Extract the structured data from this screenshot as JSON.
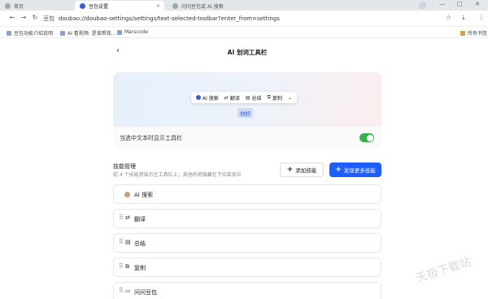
{
  "browser": {
    "tabs": [
      {
        "label": "首页",
        "active": false
      },
      {
        "label": "豆包设置",
        "active": true
      },
      {
        "label": "问问豆包或 AI 搜索",
        "active": false
      }
    ],
    "url_site": "豆包",
    "url": "doubao://doubao-settings/settings/text-selected-toolbar?enter_from=settings",
    "bookmarks": [
      "豆包功能介绍说明",
      "AI 看视频: 是谁帮我...",
      "Marscode"
    ],
    "bookmarks_right": "所有书签"
  },
  "page": {
    "title": "AI 划词工具栏",
    "back_icon": "chevron-left-icon"
  },
  "preview": {
    "toolbar_items": [
      {
        "icon": "doubao-icon",
        "label": "AI 搜索"
      },
      {
        "icon": "translate-icon",
        "label": "翻译"
      },
      {
        "icon": "summary-icon",
        "label": "总结"
      },
      {
        "icon": "copy-icon",
        "label": "复制"
      }
    ],
    "selected_text": "你好"
  },
  "toggle": {
    "label": "当选中文本时显示工具栏",
    "on": true,
    "color": "#37b24d"
  },
  "skills": {
    "title": "技能管理",
    "subtitle": "前 4 个技能将显示在工具栏上，其他的将隐藏在下拉菜单中",
    "add_label": "添加技能",
    "more_label": "发现更多技能",
    "accent": "#1e5eff",
    "items": [
      {
        "icon": "doubao-icon",
        "label": "AI 搜索"
      },
      {
        "icon": "translate-icon",
        "label": "翻译"
      },
      {
        "icon": "summary-icon",
        "label": "总结"
      },
      {
        "icon": "copy-icon",
        "label": "复制"
      },
      {
        "icon": "chat-icon",
        "label": "问问豆包"
      }
    ]
  },
  "watermark": "天极下载站"
}
